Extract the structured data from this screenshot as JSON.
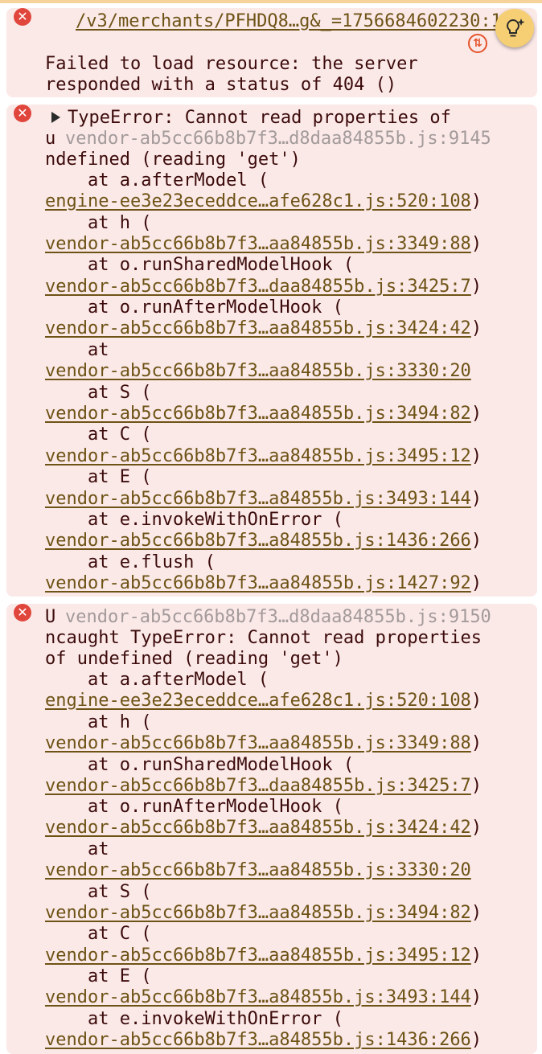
{
  "console": {
    "entries": [
      {
        "url_line": "/v3/merchants/PFHDQ8…g&_=1756684602230:1",
        "message_1": "Failed to load resource: the server",
        "message_2": "responded with a status of 404 ()"
      },
      {
        "head_text": "TypeError: Cannot read properties of",
        "u_char": "u",
        "source_link": "vendor-ab5cc66b8b7f3…d8daa84855b.js:9145",
        "cont_text": "ndefined (reading 'get')",
        "stack": [
          {
            "frame": "    at a.afterModel (",
            "link": "engine-ee3e23eceddce…afe628c1.js:520:108",
            "close": ")"
          },
          {
            "frame": "    at h (",
            "link": "vendor-ab5cc66b8b7f3…aa84855b.js:3349:88",
            "close": ")"
          },
          {
            "frame": "    at o.runSharedModelHook (",
            "link": "vendor-ab5cc66b8b7f3…daa84855b.js:3425:7",
            "close": ")"
          },
          {
            "frame": "    at o.runAfterModelHook (",
            "link": "vendor-ab5cc66b8b7f3…aa84855b.js:3424:42",
            "close": ")"
          },
          {
            "frame": "    at",
            "link": "vendor-ab5cc66b8b7f3…aa84855b.js:3330:20",
            "close": ""
          },
          {
            "frame": "    at S (",
            "link": "vendor-ab5cc66b8b7f3…aa84855b.js:3494:82",
            "close": ")"
          },
          {
            "frame": "    at C (",
            "link": "vendor-ab5cc66b8b7f3…aa84855b.js:3495:12",
            "close": ")"
          },
          {
            "frame": "    at E (",
            "link": "vendor-ab5cc66b8b7f3…a84855b.js:3493:144",
            "close": ")"
          },
          {
            "frame": "    at e.invokeWithOnError (",
            "link": "vendor-ab5cc66b8b7f3…a84855b.js:1436:266",
            "close": ")"
          },
          {
            "frame": "    at e.flush (",
            "link": "vendor-ab5cc66b8b7f3…aa84855b.js:1427:92",
            "close": ")"
          }
        ]
      },
      {
        "u_char": "U",
        "source_link": "vendor-ab5cc66b8b7f3…d8daa84855b.js:9150",
        "text_1": "ncaught TypeError: Cannot read properties",
        "text_2": "of undefined (reading 'get')",
        "stack": [
          {
            "frame": "    at a.afterModel (",
            "link": "engine-ee3e23eceddce…afe628c1.js:520:108",
            "close": ")"
          },
          {
            "frame": "    at h (",
            "link": "vendor-ab5cc66b8b7f3…aa84855b.js:3349:88",
            "close": ")"
          },
          {
            "frame": "    at o.runSharedModelHook (",
            "link": "vendor-ab5cc66b8b7f3…daa84855b.js:3425:7",
            "close": ")"
          },
          {
            "frame": "    at o.runAfterModelHook (",
            "link": "vendor-ab5cc66b8b7f3…aa84855b.js:3424:42",
            "close": ")"
          },
          {
            "frame": "    at",
            "link": "vendor-ab5cc66b8b7f3…aa84855b.js:3330:20",
            "close": ""
          },
          {
            "frame": "    at S (",
            "link": "vendor-ab5cc66b8b7f3…aa84855b.js:3494:82",
            "close": ")"
          },
          {
            "frame": "    at C (",
            "link": "vendor-ab5cc66b8b7f3…aa84855b.js:3495:12",
            "close": ")"
          },
          {
            "frame": "    at E (",
            "link": "vendor-ab5cc66b8b7f3…a84855b.js:3493:144",
            "close": ")"
          },
          {
            "frame": "    at e.invokeWithOnError (",
            "link": "vendor-ab5cc66b8b7f3…a84855b.js:1436:266",
            "close": ")"
          }
        ]
      }
    ]
  },
  "icons": {
    "error": "error-circle-icon",
    "network": "network-request-icon",
    "ai": "ai-assistance-icon"
  },
  "colors": {
    "error_bg": "#fbe9e8",
    "error_icon": "#e0463b",
    "link": "#6e5316",
    "ai_button": "#f6cf74"
  }
}
